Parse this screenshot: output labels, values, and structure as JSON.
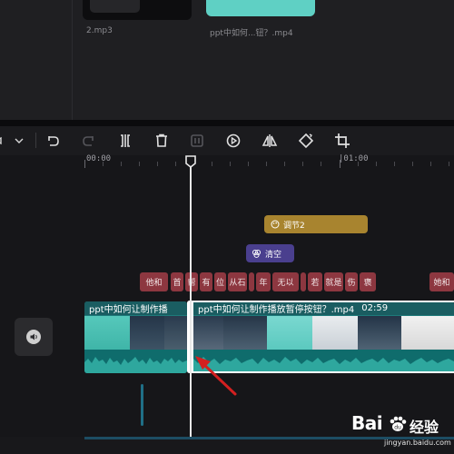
{
  "media": {
    "items": [
      {
        "filename": "2.mp3"
      },
      {
        "filename": "ppt中如何...钮？.mp4"
      }
    ]
  },
  "toolbar": {
    "icons": [
      "select-arrow-icon",
      "chevron-down-icon",
      "undo-icon",
      "redo-icon",
      "split-icon",
      "delete-icon",
      "freeze-frame-icon",
      "play-circle-icon",
      "mirror-icon",
      "rotate-icon",
      "crop-icon"
    ]
  },
  "ruler": {
    "label_start": "00:00",
    "label_end": "|01:00"
  },
  "tracks": {
    "adjust_chip": "调节2",
    "clear_chip": "清空",
    "subtitles": [
      "他和",
      "首",
      "帮",
      "有",
      "位",
      "从石",
      "",
      "年",
      "无以",
      "",
      "若",
      "就是",
      "伤",
      "褒",
      "她和"
    ],
    "clip1_title": "ppt中如何让制作播",
    "clip2_title": "ppt中如何让制作播放暂停按钮？.mp4",
    "clip2_duration": "02:59"
  },
  "watermark": {
    "brand": "Bai",
    "brand2": "经验",
    "url": "jingyan.baidu.com"
  },
  "colors": {
    "subtitle": "#8d3740",
    "adjust": "#a8842f",
    "clear": "#4a3f8e",
    "clip": "#1e7a7a",
    "arrow": "#d42020"
  }
}
